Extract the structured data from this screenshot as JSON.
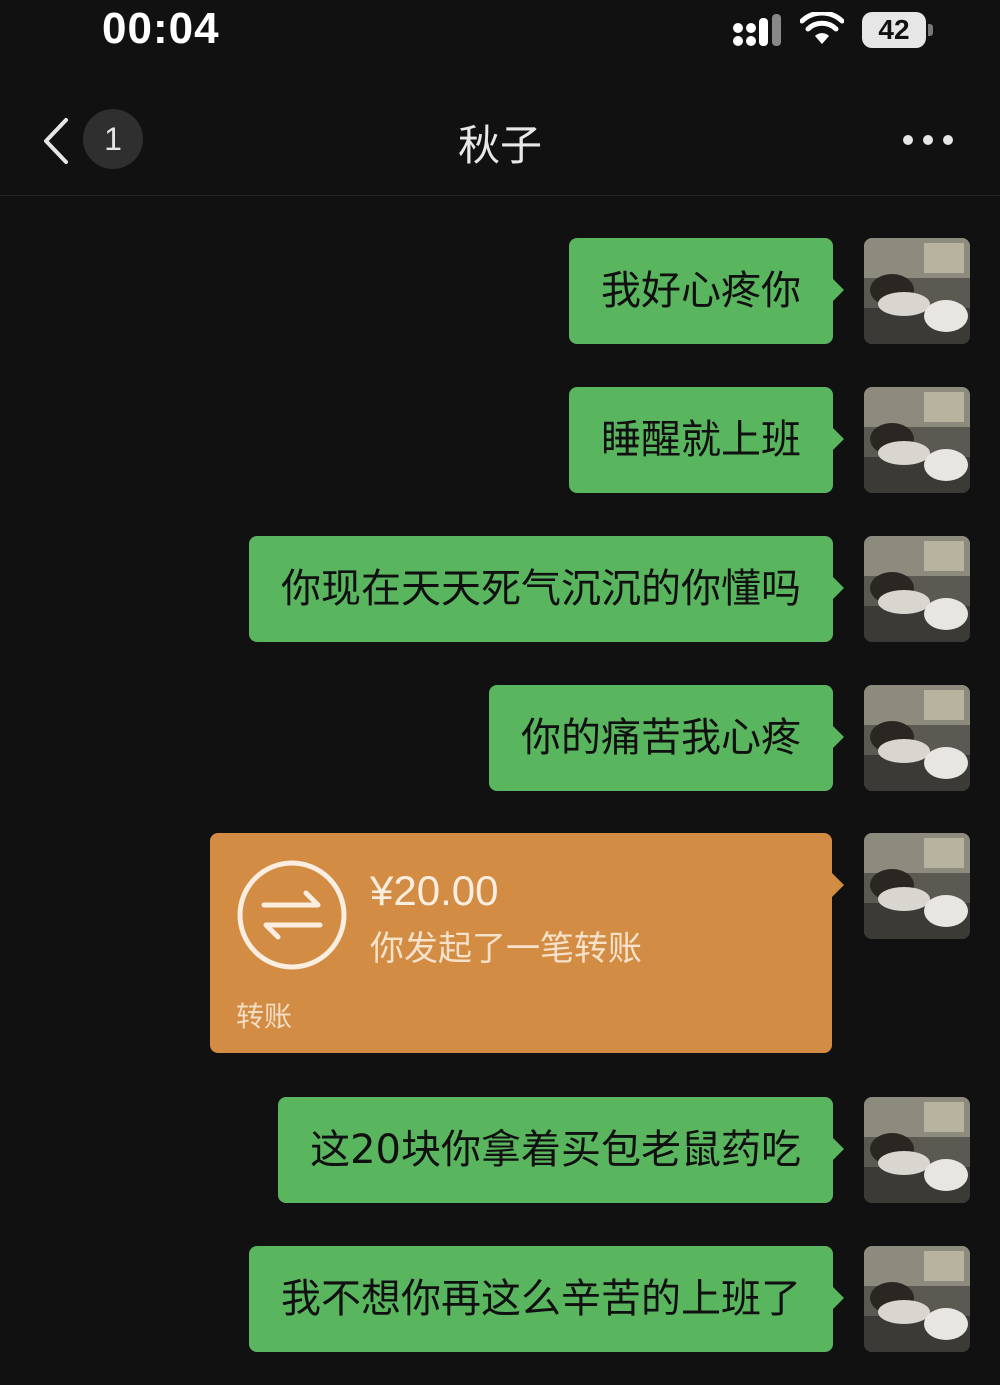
{
  "status_bar": {
    "time": "00:04",
    "battery": "42",
    "icons": [
      "signal-icon",
      "wifi-icon",
      "battery-icon"
    ]
  },
  "nav": {
    "back_icon": "chevron-left-icon",
    "unread_count": "1",
    "title": "秋子",
    "more_icon": "more-dots-icon"
  },
  "messages": [
    {
      "type": "text",
      "text": "我好心疼你"
    },
    {
      "type": "text",
      "text": "睡醒就上班"
    },
    {
      "type": "text",
      "text": "你现在天天死气沉沉的你懂吗"
    },
    {
      "type": "text",
      "text": "你的痛苦我心疼"
    },
    {
      "type": "transfer",
      "amount": "¥20.00",
      "description": "你发起了一笔转账",
      "label": "转账",
      "icon": "transfer-arrows-icon"
    },
    {
      "type": "text",
      "text": "这20块你拿着买包老鼠药吃"
    },
    {
      "type": "text",
      "text": "我不想你再这么辛苦的上班了"
    }
  ],
  "colors": {
    "background": "#111111",
    "bubble_green": "#5ab55f",
    "transfer_orange": "#d38c43"
  }
}
